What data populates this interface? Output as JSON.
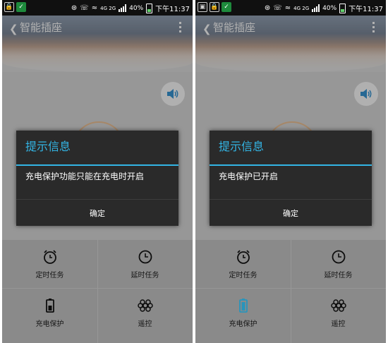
{
  "status_bar": {
    "network": "4G 2G",
    "battery_percent": "40%",
    "time": "下午11:37"
  },
  "app": {
    "title": "智能插座"
  },
  "grid_items": [
    {
      "label": "定时任务",
      "icon": "alarm-clock-icon"
    },
    {
      "label": "延时任务",
      "icon": "clock-icon"
    },
    {
      "label": "充电保护",
      "icon": "battery-icon"
    },
    {
      "label": "遥控",
      "icon": "remote-control-icon"
    }
  ],
  "dialogs": [
    {
      "title": "提示信息",
      "message": "充电保护功能只能在充电时开启",
      "confirm_label": "确定"
    },
    {
      "title": "提示信息",
      "message": "充电保护已开启",
      "confirm_label": "确定"
    }
  ],
  "colors": {
    "accent": "#33b5e5",
    "dialog_bg": "#2a2a2a",
    "active_icon": "#33b5e5"
  }
}
